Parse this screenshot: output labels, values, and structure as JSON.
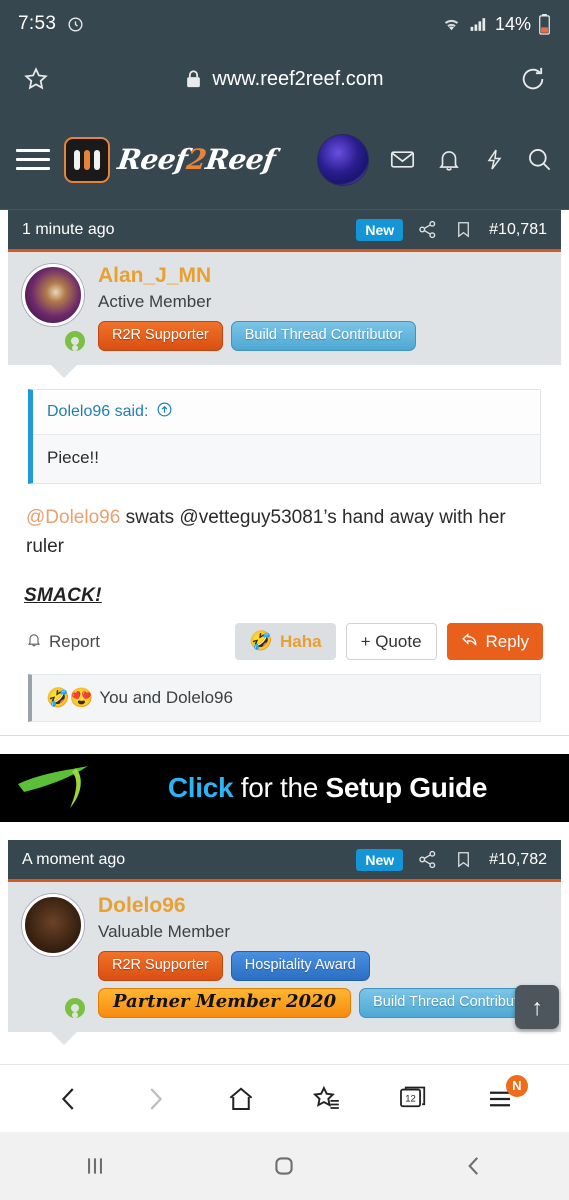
{
  "status_bar": {
    "time": "7:53",
    "battery": "14%",
    "icons": [
      "alarm-icon",
      "wifi-icon",
      "signal-icon",
      "battery-icon"
    ]
  },
  "browser": {
    "url": "www.reef2reef.com",
    "bookmark_star": "star-outline-icon",
    "reload": "reload-icon",
    "lock": "lock-icon",
    "toolbar": {
      "back": "back-arrow-icon",
      "forward": "forward-arrow-icon",
      "home": "home-icon",
      "bookmarks": "star-list-icon",
      "tabs_count": "12",
      "menu": "hamburger-menu-icon",
      "menu_badge": "N"
    }
  },
  "site_header": {
    "logo_text_1": "Reef",
    "logo_text_2": "2",
    "logo_text_3": "Reef",
    "icons": [
      "mail-icon",
      "bell-icon",
      "lightning-icon",
      "search-icon"
    ]
  },
  "posts": [
    {
      "time": "1 minute ago",
      "new_label": "New",
      "post_number": "#10,781",
      "username": "Alan_J_MN",
      "user_title": "Active Member",
      "badges": [
        {
          "label": "R2R Supporter",
          "style": "b-orange"
        },
        {
          "label": "Build Thread Contributor",
          "style": "b-lightblue"
        }
      ],
      "quote": {
        "header": "Dolelo96 said:",
        "body": "Piece!!"
      },
      "text_mention": "@Dolelo96",
      "text_rest": " swats @vetteguy53081’s hand away with her ruler",
      "emphasis": "SMACK!",
      "actions": {
        "report": "Report",
        "haha": "Haha",
        "quote": "+ Quote",
        "reply": "Reply"
      },
      "reactions": {
        "emojis": "🤣😍",
        "text": "You and Dolelo96"
      }
    },
    {
      "time": "A moment ago",
      "new_label": "New",
      "post_number": "#10,782",
      "username": "Dolelo96",
      "user_title": "Valuable Member",
      "badges": [
        {
          "label": "R2R Supporter",
          "style": "b-orange"
        },
        {
          "label": "Hospitality Award",
          "style": "b-blue"
        },
        {
          "label": "Partner Member 2020",
          "style": "b-partner"
        },
        {
          "label": "Build Thread Contributor",
          "style": "b-lightblue"
        }
      ]
    }
  ],
  "ad": {
    "word_1": "Click",
    "word_2": " for the ",
    "word_3": "Setup Guide"
  },
  "scroll_top": "↑",
  "colors": {
    "header_bg": "#37474f",
    "accent_orange": "#e8601c",
    "username_orange": "#e8a033",
    "new_badge_blue": "#1496d6",
    "quote_border": "#1f9ad6"
  }
}
